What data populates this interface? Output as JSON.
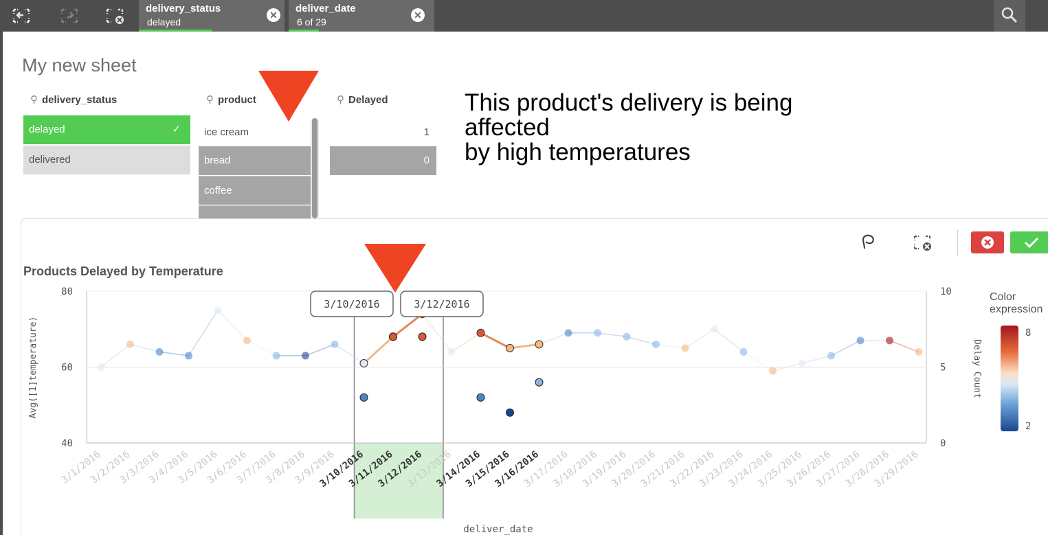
{
  "topbar": {
    "chips": [
      {
        "field": "delivery_status",
        "value": "delayed"
      },
      {
        "field": "deliver_date",
        "value": "6 of 29"
      }
    ]
  },
  "sheet": {
    "title": "My new sheet"
  },
  "filters": {
    "delivery_status": {
      "label": "delivery_status",
      "items": [
        {
          "label": "delayed",
          "check": "✓"
        },
        {
          "label": "delivered"
        }
      ]
    },
    "product": {
      "label": "product",
      "items": [
        "ice cream",
        "bread",
        "coffee"
      ]
    },
    "delayed": {
      "label": "Delayed",
      "values": [
        "1",
        "0"
      ]
    }
  },
  "annotation": {
    "lines": [
      "This product's delivery is being",
      "affected",
      "by high temperatures"
    ]
  },
  "chart_data": {
    "type": "line",
    "title": "Products Delayed by Temperature",
    "xlabel": "deliver_date",
    "ylabel": "Avg([1]temperature)",
    "y2label": "Delay Count",
    "ylim": [
      40,
      80
    ],
    "y2lim": [
      0,
      10
    ],
    "yticks": [
      "80",
      "60",
      "40"
    ],
    "y2ticks": [
      "10",
      "5",
      "0"
    ],
    "categories": [
      "3/1/2016",
      "3/2/2016",
      "3/3/2016",
      "3/4/2016",
      "3/5/2016",
      "3/6/2016",
      "3/7/2016",
      "3/8/2016",
      "3/9/2016",
      "3/10/2016",
      "3/11/2016",
      "3/12/2016",
      "3/13/2016",
      "3/14/2016",
      "3/15/2016",
      "3/16/2016",
      "3/17/2016",
      "3/18/2016",
      "3/19/2016",
      "3/20/2016",
      "3/21/2016",
      "3/22/2016",
      "3/23/2016",
      "3/24/2016",
      "3/25/2016",
      "3/26/2016",
      "3/27/2016",
      "3/28/2016",
      "3/29/2016"
    ],
    "selected_categories": [
      "3/10/2016",
      "3/11/2016",
      "3/12/2016",
      "3/14/2016",
      "3/15/2016",
      "3/16/2016"
    ],
    "temperature": [
      60,
      66,
      64,
      63,
      75,
      67,
      63,
      63,
      66,
      61,
      68,
      74,
      64,
      69,
      65,
      66,
      69,
      69,
      68,
      66,
      65,
      70,
      64,
      59,
      61,
      63,
      67,
      67,
      64
    ],
    "delay_count": [
      5,
      6,
      3,
      3,
      5,
      6,
      4,
      2,
      4,
      5,
      7,
      6,
      5,
      7,
      6,
      6,
      3,
      4,
      4,
      4,
      6,
      5,
      4,
      6,
      5,
      4,
      3,
      8,
      6
    ],
    "delay_count_2": [
      null,
      null,
      null,
      null,
      null,
      null,
      null,
      null,
      null,
      3,
      7,
      7,
      null,
      3,
      2,
      4,
      null,
      null,
      null,
      null,
      null,
      null,
      null,
      null,
      null,
      null,
      null,
      null,
      null
    ],
    "range_labels": [
      "3/10/2016",
      "3/12/2016"
    ],
    "legend": {
      "title": "Color expression",
      "max": "8",
      "min": "2"
    }
  }
}
